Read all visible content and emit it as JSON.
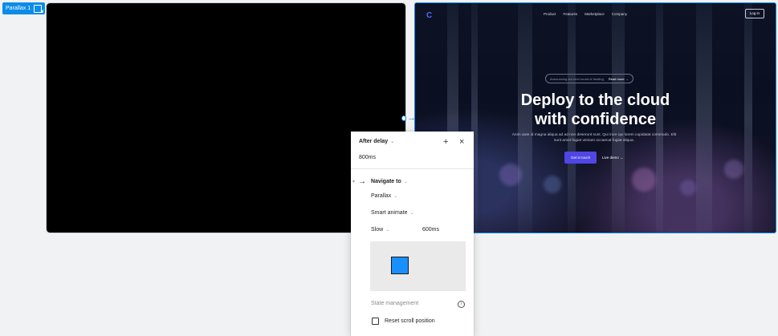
{
  "frame_label": "Parallax 1",
  "website": {
    "logo": "C",
    "nav": [
      "Product",
      "Features",
      "Marketplace",
      "Company"
    ],
    "login": "Log in",
    "announcement": "Announcing our next round of funding.",
    "announcement_link": "Read more →",
    "headline_line1": "Deploy to the cloud",
    "headline_line2": "with confidence",
    "subtext": "Anim aute id magna aliqua ad ad non deserunt sunt. Qui irure qui lorem cupidatat commodo. Elit sunt amet fugiat veniam occaecat fugiat aliqua.",
    "cta": "Get in touch",
    "secondary_link": "Live demo →"
  },
  "interaction": {
    "trigger": "After delay",
    "delay": "800ms",
    "action": "Navigate to",
    "destination": "Parallax",
    "animation": "Smart animate",
    "easing": "Slow",
    "duration": "600ms",
    "state_management": "State management",
    "reset_scroll": "Reset scroll position"
  },
  "colors": {
    "accent": "#0c8ce9",
    "preview_square": "#1890ff",
    "cta": "#4f46e5"
  }
}
